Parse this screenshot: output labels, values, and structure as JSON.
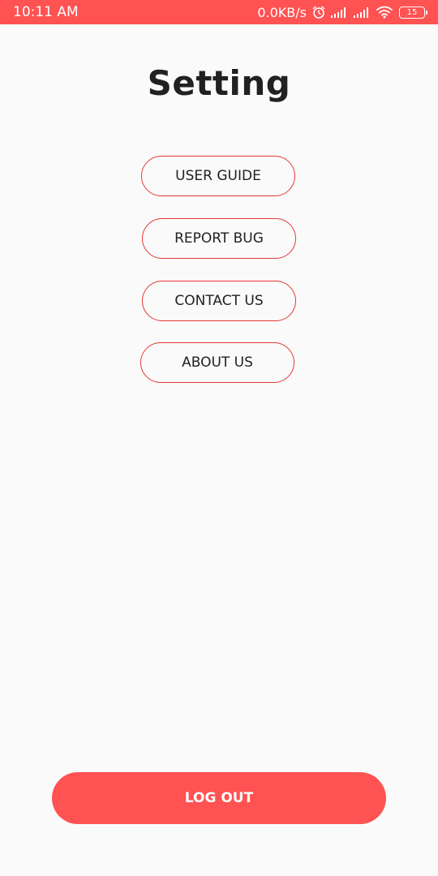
{
  "status_bar": {
    "time": "10:11 AM",
    "network_speed": "0.0KB/s",
    "battery_level": "15",
    "icons": [
      "alarm-icon",
      "signal-icon",
      "signal-icon",
      "wifi-icon",
      "battery-icon"
    ],
    "background_color": "#ff5252"
  },
  "page": {
    "title": "Setting"
  },
  "menu": {
    "items": [
      {
        "label": "USER GUIDE"
      },
      {
        "label": "REPORT BUG"
      },
      {
        "label": "CONTACT US"
      },
      {
        "label": "ABOUT US"
      }
    ],
    "border_color": "#e53935"
  },
  "footer": {
    "logout_label": "LOG OUT",
    "accent_color": "#ff5252"
  }
}
